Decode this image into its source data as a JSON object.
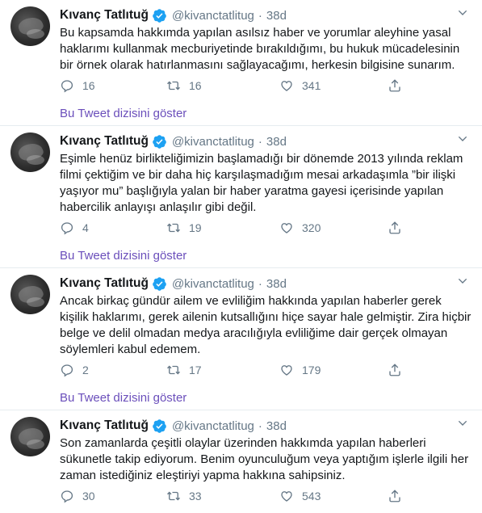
{
  "author": {
    "name": "Kıvanç Tatlıtuğ",
    "handle": "@kivanctatlitug",
    "time": "38d"
  },
  "show_thread_label": "Bu Tweet dizisini göster",
  "tweets": [
    {
      "text": "Bu kapsamda hakkımda yapılan asılsız haber ve yorumlar aleyhine yasal haklarımı kullanmak mecburiyetinde bırakıldığımı, bu hukuk mücadelesinin bir örnek olarak hatırlanmasını sağlayacağımı, herkesin bilgisine sunarım.",
      "replies": "16",
      "retweets": "16",
      "likes": "341"
    },
    {
      "text": "Eşimle henüz birlikteliğimizin başlamadığı bir dönemde 2013 yılında reklam filmi çektiğim ve bir daha hiç karşılaşmadığım mesai arkadaşımla ”bir ilişki yaşıyor mu” başlığıyla yalan bir haber yaratma gayesi içerisinde yapılan habercilik anlayışı anlaşılır gibi değil.",
      "replies": "4",
      "retweets": "19",
      "likes": "320"
    },
    {
      "text": "Ancak birkaç gündür ailem ve evliliğim hakkında yapılan haberler gerek kişilik haklarımı, gerek ailenin kutsallığını hiçe sayar hale gelmiştir. Zira hiçbir belge ve delil olmadan medya aracılığıyla evliliğime dair gerçek olmayan söylemleri kabul edemem.",
      "replies": "2",
      "retweets": "17",
      "likes": "179"
    },
    {
      "text": "Son zamanlarda çeşitli olaylar üzerinden hakkımda yapılan haberleri sükunetle takip ediyorum. Benim oyunculuğum veya yaptığım işlerle ilgili her zaman istediğiniz eleştiriyi yapma hakkına sahipsiniz.",
      "replies": "30",
      "retweets": "33",
      "likes": "543"
    }
  ],
  "icons": {
    "verified": "verified-badge-icon",
    "more": "chevron-down-icon",
    "reply": "reply-icon",
    "retweet": "retweet-icon",
    "like": "heart-icon",
    "share": "share-icon"
  },
  "colors": {
    "verified": "#1da1f2",
    "link": "#6b4fbb",
    "muted": "#657786",
    "divider": "#e6ecf0"
  }
}
